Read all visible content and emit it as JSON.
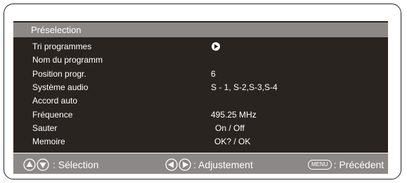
{
  "menu": {
    "title": "Préselection",
    "rows": [
      {
        "label": "Tri  programmes",
        "value_icon": "play-circle-icon",
        "value": ""
      },
      {
        "label": "Nom du programm",
        "value": ""
      },
      {
        "label": "Position progr.",
        "value": "6"
      },
      {
        "label": "Système audio",
        "value": "S - 1, S-2,S-3,S-4"
      },
      {
        "label": "Accord auto",
        "value": ""
      },
      {
        "label": "Fréquence",
        "value": "495.25 MHz"
      },
      {
        "label": "Sauter",
        "value": "On / Off"
      },
      {
        "label": "Memoire",
        "value": "OK? / OK"
      }
    ]
  },
  "help": {
    "selection": ": Sélection",
    "adjust": ": Adjustement",
    "menu_key": "MENU",
    "previous": ": Précédent"
  },
  "colors": {
    "panel_bg": "#2a2420",
    "bar_bg": "#8c8886",
    "text": "#ffffff"
  }
}
